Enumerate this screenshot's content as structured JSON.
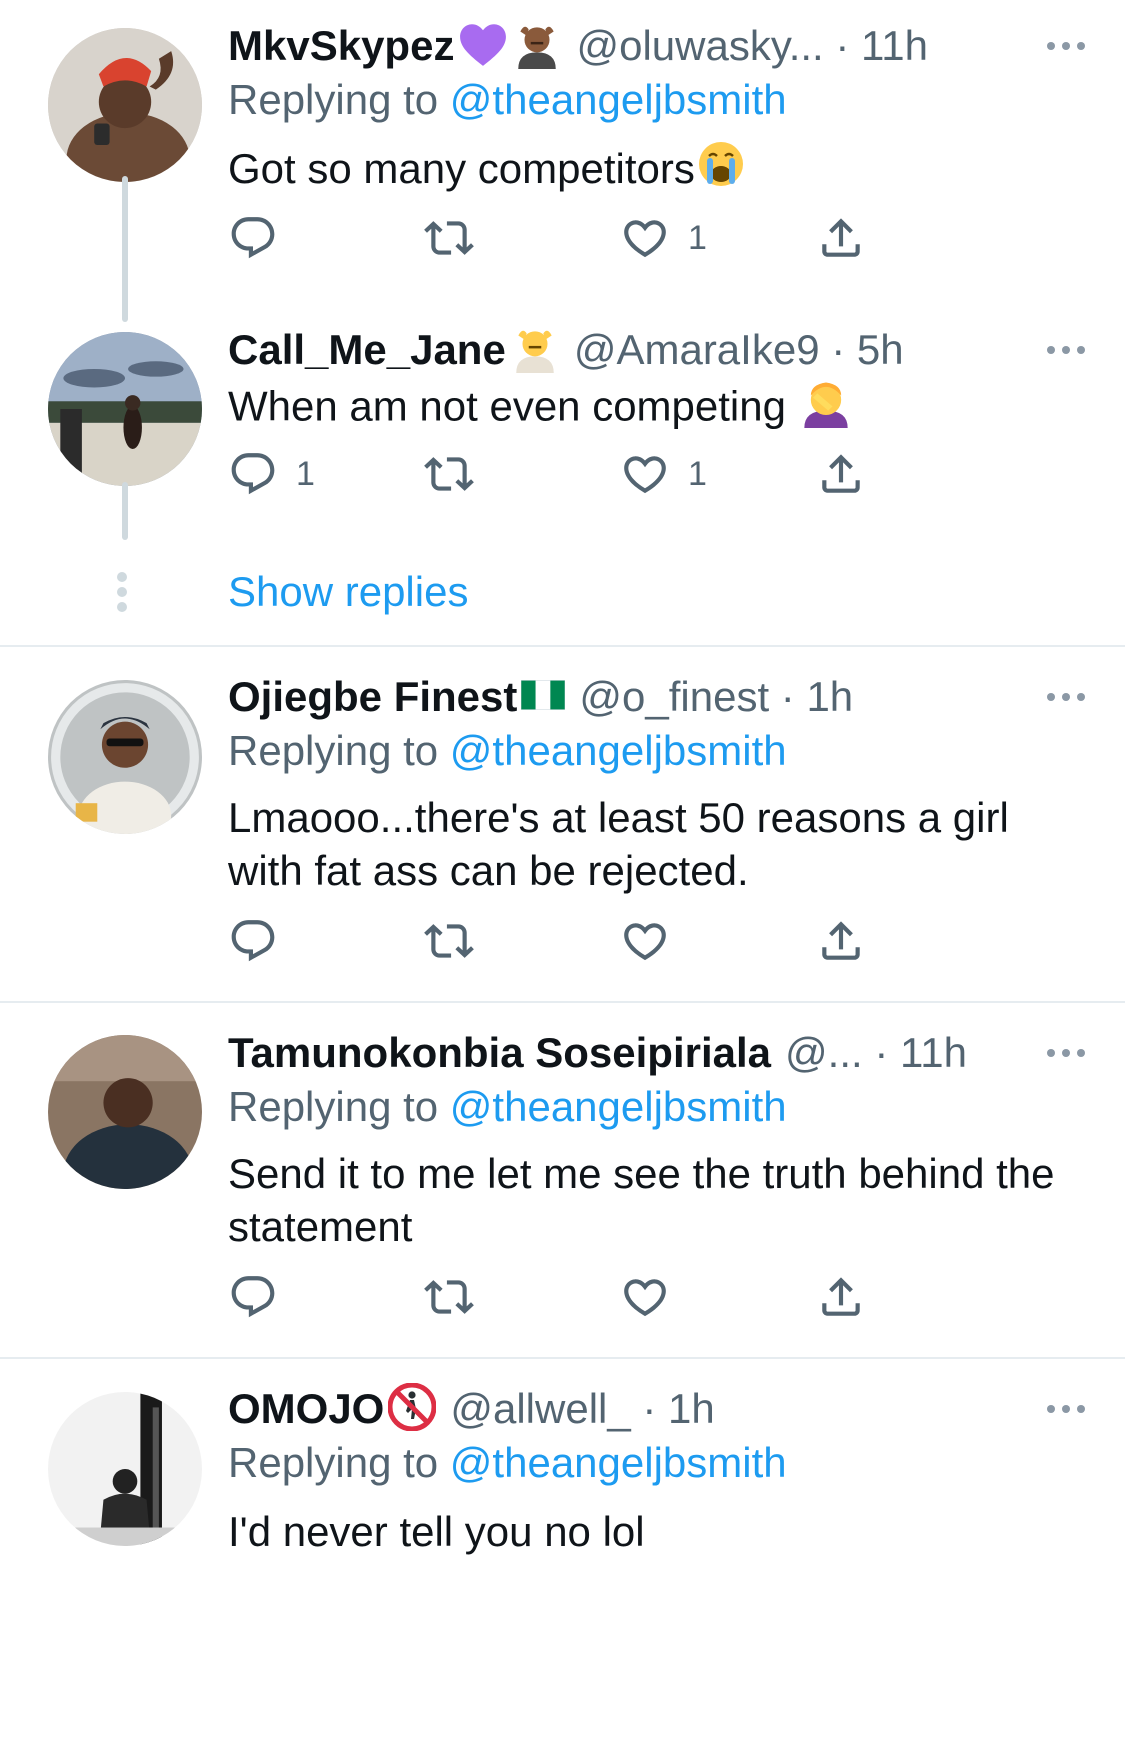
{
  "tweets": [
    {
      "name": "MkvSkypez",
      "name_emojis": [
        "purple-heart",
        "massage-man"
      ],
      "handle_time": "@oluwasky... · 11h",
      "replying_prefix": "Replying to",
      "replying_to": "@theangeljbsmith",
      "text": "Got so many competitors",
      "text_emoji": "crying-face",
      "reply_count": "",
      "retweet_count": "",
      "like_count": "1"
    },
    {
      "name": "Call_Me_Jane",
      "name_emojis": [
        "massage-woman"
      ],
      "handle_time": "@AmaraIke9 · 5h",
      "replying_prefix": "",
      "replying_to": "",
      "text": "When am not even competing",
      "text_emoji": "facepalm-woman",
      "reply_count": "1",
      "retweet_count": "",
      "like_count": "1"
    },
    {
      "name": "Ojiegbe Finest",
      "name_emojis": [
        "nigeria-flag"
      ],
      "handle_time": "@o_finest · 1h",
      "replying_prefix": "Replying to",
      "replying_to": "@theangeljbsmith",
      "text": "Lmaooo...there's at least 50 reasons a girl with fat ass can be rejected.",
      "reply_count": "",
      "retweet_count": "",
      "like_count": ""
    },
    {
      "name": "Tamunokonbia Soseipiriala",
      "name_emojis": [],
      "handle_time": "@... · 11h",
      "replying_prefix": "Replying to",
      "replying_to": "@theangeljbsmith",
      "text": "Send it to me let me see the truth behind the statement",
      "reply_count": "",
      "retweet_count": "",
      "like_count": ""
    },
    {
      "name": "OMOJO",
      "name_emojis": [
        "no-pedestrians"
      ],
      "handle_time": "@allwell_ · 1h",
      "replying_prefix": "Replying to",
      "replying_to": "@theangeljbsmith",
      "text": "I'd never tell you no lol"
    }
  ],
  "show_replies": "Show replies",
  "colors": {
    "link": "#1d9bf0",
    "secondary_text": "#536471",
    "divider": "#e6ecf0",
    "thread_line": "#cfd9de"
  },
  "icons": [
    "reply-icon",
    "retweet-icon",
    "like-icon",
    "share-icon",
    "more-icon"
  ]
}
